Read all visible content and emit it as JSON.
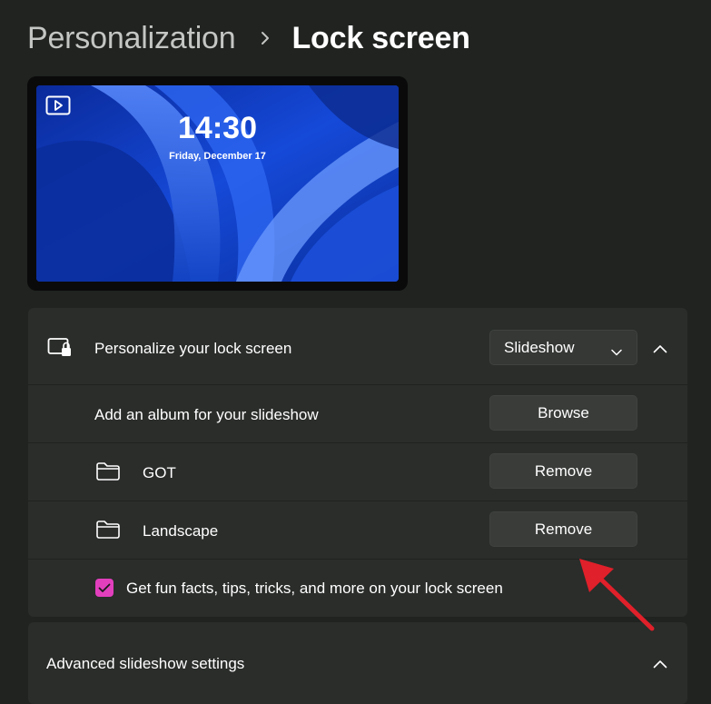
{
  "breadcrumb": {
    "parent": "Personalization",
    "current": "Lock screen"
  },
  "preview": {
    "time": "14:30",
    "date": "Friday, December 17"
  },
  "personalize": {
    "label": "Personalize your lock screen",
    "selected": "Slideshow",
    "icon": "lock-screen-icon"
  },
  "album": {
    "label": "Add an album for your slideshow",
    "button": "Browse"
  },
  "folders": [
    {
      "name": "GOT",
      "button": "Remove"
    },
    {
      "name": "Landscape",
      "button": "Remove"
    }
  ],
  "fun_facts": {
    "label": "Get fun facts, tips, tricks, and more on your lock screen",
    "checked": true
  },
  "advanced": {
    "label": "Advanced slideshow settings"
  },
  "colors": {
    "accent": "#e23fbd",
    "annotation_arrow": "#e0202a"
  }
}
